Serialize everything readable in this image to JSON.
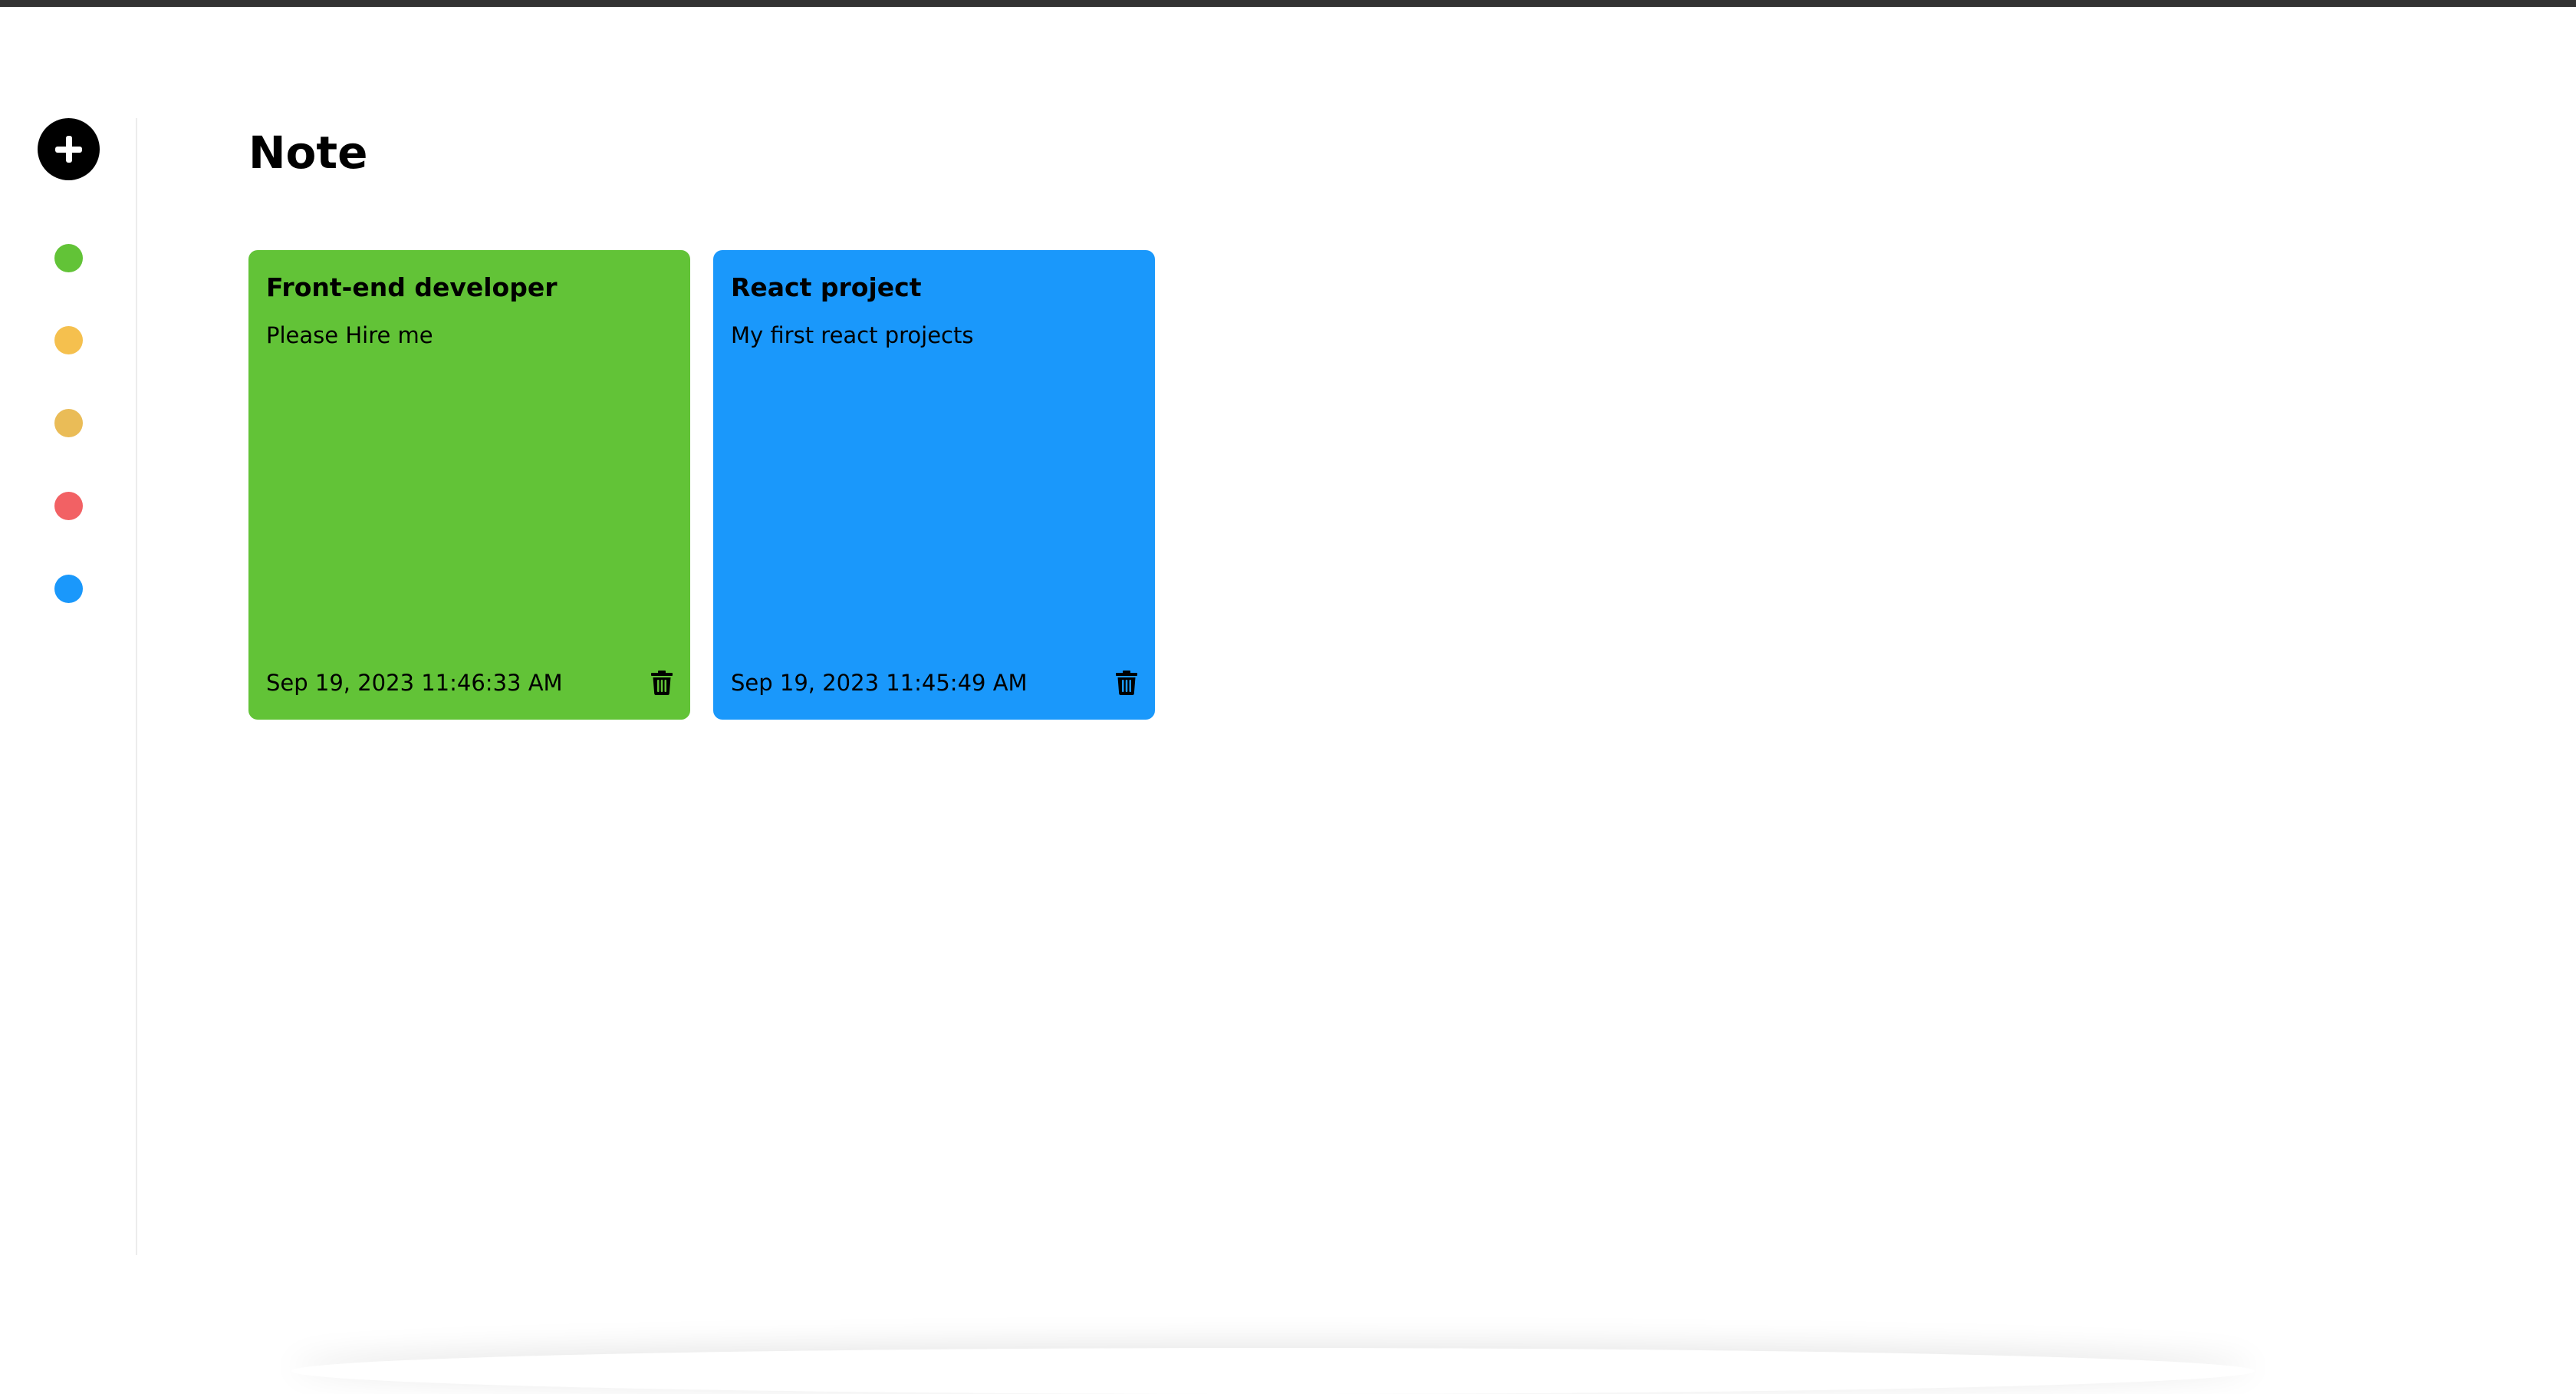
{
  "app": {
    "title": "Note"
  },
  "sidebar": {
    "add_button_icon": "plus-icon",
    "colors": [
      {
        "name": "green",
        "hex": "#62c337"
      },
      {
        "name": "yellow",
        "hex": "#f5c04e"
      },
      {
        "name": "orange",
        "hex": "#eabc57"
      },
      {
        "name": "red",
        "hex": "#f26164"
      },
      {
        "name": "blue",
        "hex": "#1a98fb"
      }
    ]
  },
  "notes": [
    {
      "title": "Front-end developer",
      "body": "Please Hire me",
      "date": "Sep 19, 2023 11:46:33 AM",
      "color": "#62c337",
      "delete_icon": "trash-icon"
    },
    {
      "title": "React project",
      "body": "My first react projects",
      "date": "Sep 19, 2023 11:45:49 AM",
      "color": "#1a98fb",
      "delete_icon": "trash-icon"
    }
  ]
}
